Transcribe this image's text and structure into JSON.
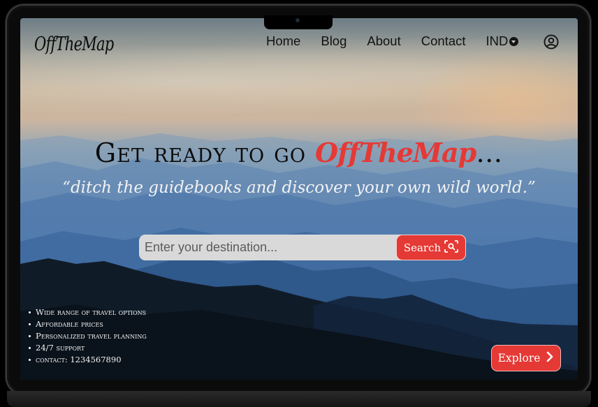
{
  "brand": {
    "logo_text": "OffTheMap",
    "accent_color": "#e53935"
  },
  "nav": {
    "links": [
      {
        "label": "Home"
      },
      {
        "label": "Blog"
      },
      {
        "label": "About"
      },
      {
        "label": "Contact"
      }
    ],
    "currency": {
      "label": "IND",
      "icon": "caret-down-circle-icon"
    },
    "account": {
      "icon": "user-circle-icon"
    }
  },
  "hero": {
    "title_prefix": "Get ready to go ",
    "title_brand": "OffTheMap",
    "title_suffix": "…",
    "tagline": "“ditch the guidebooks and discover your own wild world.”"
  },
  "search": {
    "placeholder": "Enter your destination...",
    "value": "",
    "button_label": "Search",
    "button_icon": "scan-search-icon"
  },
  "features": [
    "Wide range of travel options",
    "Affordable prices",
    "Personalized travel planning",
    "24/7 support",
    "contact: 1234567890"
  ],
  "explore": {
    "label": "Explore",
    "icon": "chevron-right-icon"
  }
}
